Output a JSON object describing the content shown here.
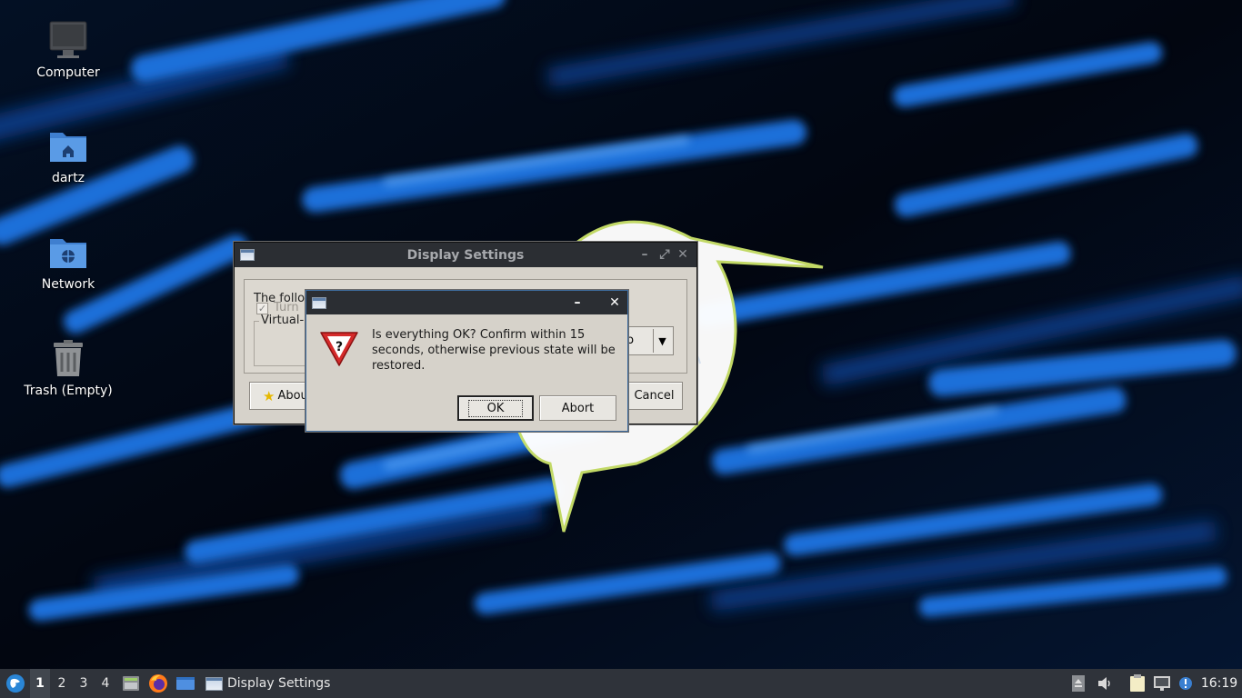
{
  "desktop": {
    "icons": [
      {
        "label": "Computer",
        "icon": "monitor-icon"
      },
      {
        "label": "dartz",
        "icon": "home-folder-icon"
      },
      {
        "label": "Network",
        "icon": "network-folder-icon"
      },
      {
        "label": "Trash (Empty)",
        "icon": "trash-icon"
      }
    ]
  },
  "display_settings": {
    "title": "Display Settings",
    "intro_text": "The follo",
    "group_title": "Virtual-1",
    "checkbox_label": "Turn",
    "combo_value": "to",
    "about_label": "Abou",
    "cancel_label": "Cancel"
  },
  "dialog": {
    "message": "Is everything OK? Confirm within 15 seconds, otherwise previous state will be restored.",
    "ok_label": "OK",
    "abort_label": "Abort",
    "minimize_glyph": "–",
    "close_glyph": "✕"
  },
  "taskbar": {
    "workspaces": [
      "1",
      "2",
      "3",
      "4"
    ],
    "active_workspace": "1",
    "task_label": "Display Settings",
    "clock": "16:19"
  },
  "colors": {
    "titlebar": "#2b2e33",
    "window_bg": "#d6d2ca",
    "taskbar": "#2f333a",
    "wallpaper_blue": "#1e6fd9"
  }
}
